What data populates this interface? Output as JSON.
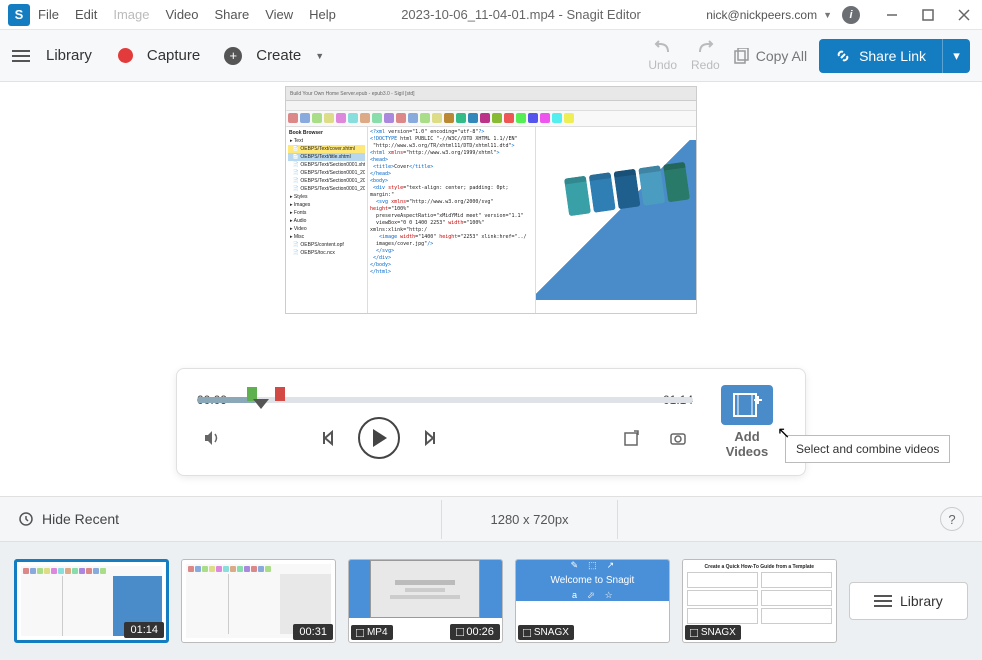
{
  "app": {
    "logo_letter": "S",
    "title": "2023-10-06_11-04-01.mp4 - Snagit Editor",
    "user": "nick@nickpeers.com"
  },
  "menu": {
    "file": "File",
    "edit": "Edit",
    "image": "Image",
    "video": "Video",
    "share": "Share",
    "view": "View",
    "help": "Help"
  },
  "toolbar": {
    "library": "Library",
    "capture": "Capture",
    "create": "Create",
    "undo": "Undo",
    "redo": "Redo",
    "copy_all": "Copy All",
    "share_link": "Share Link"
  },
  "player": {
    "time_current": "00:09",
    "time_total": "01:14",
    "add_videos_line1": "Add",
    "add_videos_line2": "Videos",
    "tooltip": "Select and combine videos"
  },
  "statusbar": {
    "hide_recent": "Hide Recent",
    "dimensions": "1280 x 720px",
    "help": "?"
  },
  "tray": {
    "library_btn": "Library",
    "thumbs": [
      {
        "badge_right": "01:14"
      },
      {
        "badge_right": "00:31"
      },
      {
        "badge_left": "MP4",
        "badge_right": "00:26"
      },
      {
        "badge_left": "SNAGX",
        "welcome": "Welcome to Snagit"
      },
      {
        "badge_left": "SNAGX"
      }
    ]
  }
}
